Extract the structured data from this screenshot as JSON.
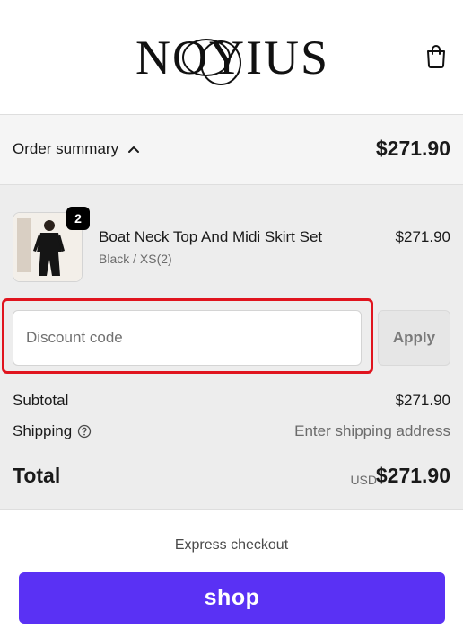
{
  "header": {
    "logo_text": "NOYIUS",
    "cart_icon": "shopping-bag-icon"
  },
  "summary": {
    "toggle_label": "Order summary",
    "toggle_icon": "chevron-up-icon",
    "total": "$271.90"
  },
  "line_items": [
    {
      "quantity": "2",
      "name": "Boat Neck Top And Midi Skirt Set",
      "variant": "Black / XS(2)",
      "price": "$271.90"
    }
  ],
  "discount": {
    "placeholder": "Discount code",
    "value": "",
    "apply_label": "Apply"
  },
  "totals": {
    "subtotal_label": "Subtotal",
    "subtotal_value": "$271.90",
    "shipping_label": "Shipping",
    "shipping_icon": "help-circle-icon",
    "shipping_value": "Enter shipping address",
    "total_label": "Total",
    "currency": "USD",
    "total_value": "$271.90"
  },
  "express": {
    "label": "Express checkout",
    "shop_pay_label": "shop"
  },
  "colors": {
    "highlight": "#e0141e",
    "shop_pay": "#5a31f4"
  }
}
